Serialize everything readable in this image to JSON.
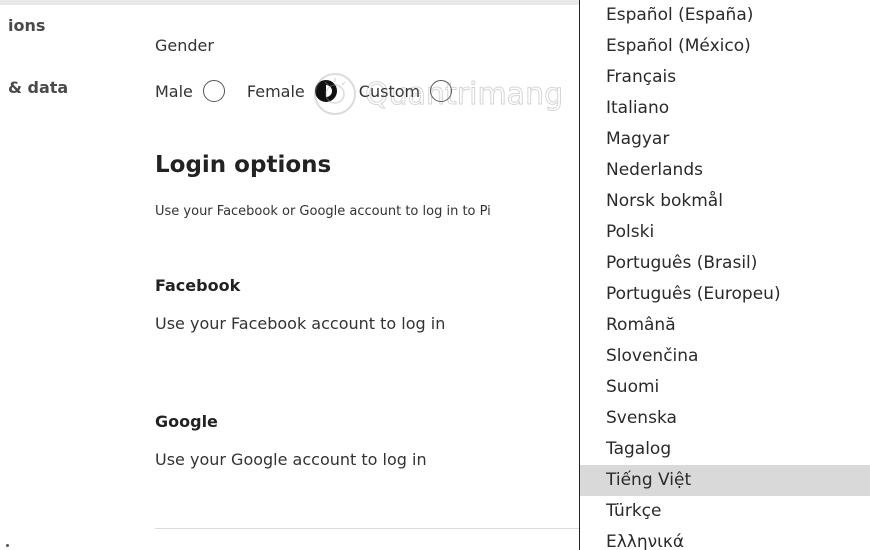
{
  "sidebar": {
    "items": [
      {
        "label": "ions"
      },
      {
        "label": "& data"
      }
    ]
  },
  "gender": {
    "label": "Gender",
    "options": [
      {
        "label": "Male",
        "selected": false
      },
      {
        "label": "Female",
        "selected": true
      },
      {
        "label": "Custom",
        "selected": false
      }
    ]
  },
  "login": {
    "title": "Login options",
    "description": "Use your Facebook or Google account to log in to Pi",
    "facebook": {
      "title": "Facebook",
      "description": "Use your Facebook account to log in"
    },
    "google": {
      "title": "Google",
      "description": "Use your Google account to log in"
    }
  },
  "language_menu": {
    "items": [
      "Español (España)",
      "Español (México)",
      "Français",
      "Italiano",
      "Magyar",
      "Nederlands",
      "Norsk bokmål",
      "Polski",
      "Português (Brasil)",
      "Português (Europeu)",
      "Română",
      "Slovenčina",
      "Suomi",
      "Svenska",
      "Tagalog",
      "Tiếng Việt",
      "Türkçe",
      "Ελληνικά"
    ],
    "highlighted": "Tiếng Việt"
  },
  "colors": {
    "highlight": "#d9d9d9",
    "text": "#222222",
    "panel_border": "#222222"
  },
  "watermark_text": "Quantrimang"
}
